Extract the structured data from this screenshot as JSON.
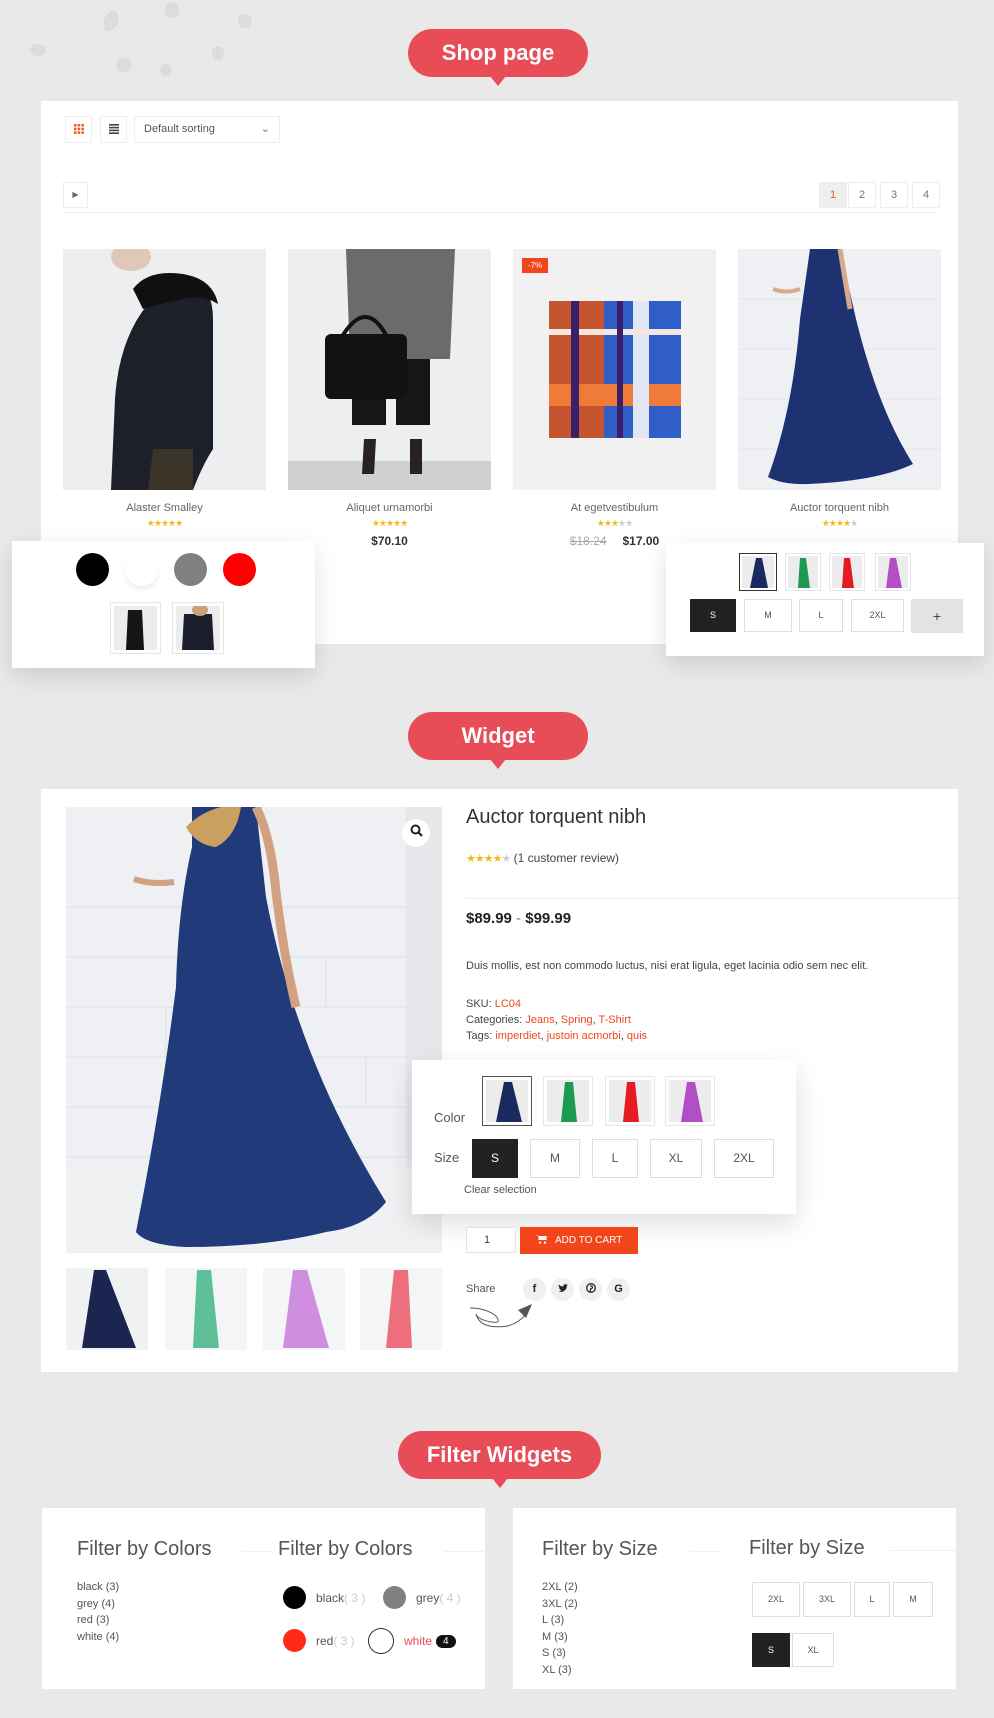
{
  "sections": {
    "shop_label": "Shop page",
    "widget_label": "Widget",
    "filter_label": "Filter Widgets"
  },
  "colors": {
    "accent_bubble": "#e84c57",
    "brand_orange": "#f2461a",
    "star": "#f2b91a",
    "selected_dark": "#222222"
  },
  "shop": {
    "view_grid_icon": "grid-icon",
    "view_list_icon": "list-icon",
    "sort_select_value": "Default sorting",
    "pager_prev_icon": "caret-right-icon",
    "pages": [
      "1",
      "2",
      "3",
      "4"
    ],
    "active_page": "1",
    "products": [
      {
        "name": "Alaster Smalley",
        "stars": "★★★★★",
        "stars_off": "",
        "rating": 5,
        "price": "",
        "old_price": "",
        "badge": ""
      },
      {
        "name": "Aliquet urnamorbi",
        "stars": "★★★★★",
        "stars_off": "",
        "rating": 5,
        "price": "$70.10",
        "old_price": "",
        "badge": ""
      },
      {
        "name": "At egetvestibulum",
        "stars": "★★★",
        "stars_off": "★★",
        "rating": 3,
        "price": "$17.00",
        "old_price": "$18.24",
        "badge": "-7%"
      },
      {
        "name": "Auctor torquent nibh",
        "stars": "★★★★",
        "stars_off": "★",
        "rating": 4,
        "price": "",
        "old_price": "",
        "badge": ""
      }
    ],
    "color_swatch_card": {
      "swatches": [
        {
          "name": "black",
          "color": "#000000"
        },
        {
          "name": "white",
          "color": "#ffffff"
        },
        {
          "name": "grey",
          "color": "#808080"
        },
        {
          "name": "red",
          "color": "#ff0000"
        }
      ],
      "image_swatches": [
        "black jacket",
        "black blazer"
      ]
    },
    "variation_card": {
      "image_swatches": [
        {
          "name": "navy",
          "color": "#1b2a5e",
          "selected": true
        },
        {
          "name": "green",
          "color": "#1c9a52",
          "selected": false
        },
        {
          "name": "red",
          "color": "#e41b23",
          "selected": false
        },
        {
          "name": "purple",
          "color": "#b24fc4",
          "selected": false
        }
      ],
      "sizes": [
        "S",
        "M",
        "L",
        "2XL"
      ],
      "selected_size": "S",
      "more_label": "+"
    }
  },
  "widget": {
    "title": "Auctor torquent nibh",
    "stars": "★★★★",
    "stars_off": "★",
    "rating": 4,
    "review_text": "(1 customer review)",
    "price_min": "$89.99",
    "price_sep": " - ",
    "price_max": "$99.99",
    "description": "Duis mollis, est non commodo luctus, nisi erat ligula, eget lacinia odio sem nec elit.",
    "sku_label": "SKU: ",
    "sku": "LC04",
    "categories_label": "Categories: ",
    "categories": [
      "Jeans",
      "Spring",
      "T-Shirt"
    ],
    "tags_label": "Tags: ",
    "tags": [
      "imperdiet",
      "justoin acmorbi",
      "quis"
    ],
    "color_label": "Color",
    "size_label": "Size",
    "color_options": [
      {
        "name": "navy",
        "color": "#1b2a5e",
        "selected": true
      },
      {
        "name": "green",
        "color": "#1c9a52",
        "selected": false
      },
      {
        "name": "red",
        "color": "#e41b23",
        "selected": false
      },
      {
        "name": "purple",
        "color": "#b24fc4",
        "selected": false
      }
    ],
    "size_options": [
      "S",
      "M",
      "L",
      "XL",
      "2XL"
    ],
    "selected_size": "S",
    "clear_selection": "Clear selection",
    "quantity": "1",
    "add_to_cart": "ADD TO CART",
    "share_label": "Share",
    "social": [
      {
        "name": "facebook",
        "glyph": "f"
      },
      {
        "name": "twitter",
        "glyph": "t"
      },
      {
        "name": "pinterest",
        "glyph": "p"
      },
      {
        "name": "google",
        "glyph": "G"
      }
    ],
    "gallery_thumbs": [
      {
        "name": "navy",
        "color": "#1b2a5e"
      },
      {
        "name": "mint",
        "color": "#5fbf98"
      },
      {
        "name": "lilac",
        "color": "#cf8ee0"
      },
      {
        "name": "coral",
        "color": "#ee6f7c"
      }
    ]
  },
  "filters": {
    "colors_list": {
      "title": "Filter by Colors",
      "items": [
        {
          "label": "black",
          "count": "(3)"
        },
        {
          "label": "grey",
          "count": "(4)"
        },
        {
          "label": "red",
          "count": "(3)"
        },
        {
          "label": "white",
          "count": "(4)"
        }
      ]
    },
    "colors_swatch": {
      "title": "Filter by Colors",
      "items": [
        {
          "label": "black",
          "count": "( 3 )",
          "color": "#000000",
          "active": false
        },
        {
          "label": "grey",
          "count": "( 4 )",
          "color": "#808080",
          "active": false
        },
        {
          "label": "red",
          "count": "( 3 )",
          "color": "#ff2a1a",
          "active": false
        },
        {
          "label": "white",
          "count": "4",
          "color": "#ffffff",
          "active": true
        }
      ]
    },
    "size_list": {
      "title": "Filter by Size",
      "items": [
        {
          "label": "2XL",
          "count": "(2)"
        },
        {
          "label": "3XL",
          "count": "(2)"
        },
        {
          "label": "L",
          "count": "(3)"
        },
        {
          "label": "M",
          "count": "(3)"
        },
        {
          "label": "S",
          "count": "(3)"
        },
        {
          "label": "XL",
          "count": "(3)"
        }
      ]
    },
    "size_buttons": {
      "title": "Filter by Size",
      "row1": [
        "2XL",
        "3XL",
        "L",
        "M"
      ],
      "row2": [
        "S",
        "XL"
      ],
      "selected": "S"
    }
  }
}
